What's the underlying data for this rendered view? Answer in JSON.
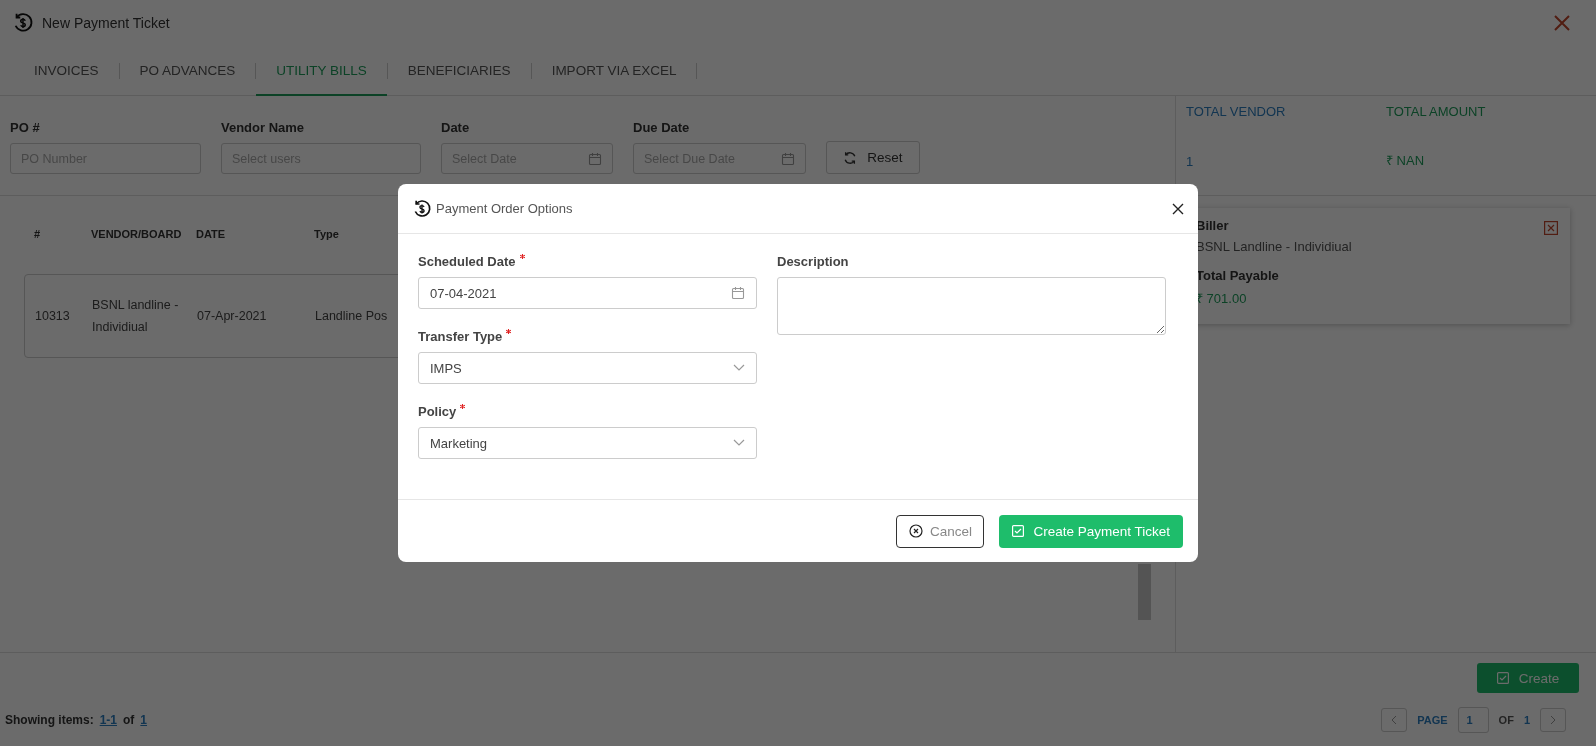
{
  "window": {
    "title": "New Payment Ticket"
  },
  "tabs": [
    {
      "label": "INVOICES",
      "selected": false
    },
    {
      "label": "PO ADVANCES",
      "selected": false
    },
    {
      "label": "UTILITY BILLS",
      "selected": true
    },
    {
      "label": "BENEFICIARIES",
      "selected": false
    },
    {
      "label": "IMPORT VIA EXCEL",
      "selected": false
    }
  ],
  "filters": [
    {
      "label": "PO #",
      "placeholder": "PO Number",
      "kind": "text"
    },
    {
      "label": "Vendor Name",
      "placeholder": "Select users",
      "kind": "text"
    },
    {
      "label": "Date",
      "placeholder": "Select Date",
      "kind": "date"
    },
    {
      "label": "Due Date",
      "placeholder": "Select Due Date",
      "kind": "date"
    }
  ],
  "reset_button": "Reset",
  "totals": [
    {
      "label": "TOTAL VENDOR",
      "value": "1",
      "kind": "count"
    },
    {
      "label": "TOTAL AMOUNT",
      "value": "₹ NAN",
      "kind": "amount"
    }
  ],
  "table": {
    "columns": [
      "#",
      "VENDOR/BOARD",
      "DATE",
      "Type"
    ],
    "rows": [
      [
        "10313",
        "BSNL landline - Individiual",
        "07-Apr-2021",
        "Landline Pos"
      ]
    ]
  },
  "biller_card": {
    "biller_label": "Biller",
    "biller": "BSNL Landline - Individiual",
    "payable_label": "Total Payable",
    "payable": "₹ 701.00"
  },
  "create_button": "Create",
  "footer": {
    "showing_label": "Showing items:",
    "range": "1-1",
    "of": "of",
    "total": "1",
    "page_label": "PAGE",
    "page": "1",
    "of_label": "OF",
    "pages": "1"
  },
  "modal": {
    "title": "Payment Order Options",
    "fields": [
      {
        "label": "Scheduled Date",
        "required": true,
        "value": "07-04-2021",
        "kind": "date"
      },
      {
        "label": "Transfer Type",
        "required": true,
        "value": "IMPS",
        "kind": "select"
      },
      {
        "label": "Policy",
        "required": true,
        "value": "Marketing",
        "kind": "select"
      }
    ],
    "description": {
      "label": "Description"
    },
    "cancel_button": "Cancel",
    "submit_button": "Create Payment Ticket"
  }
}
